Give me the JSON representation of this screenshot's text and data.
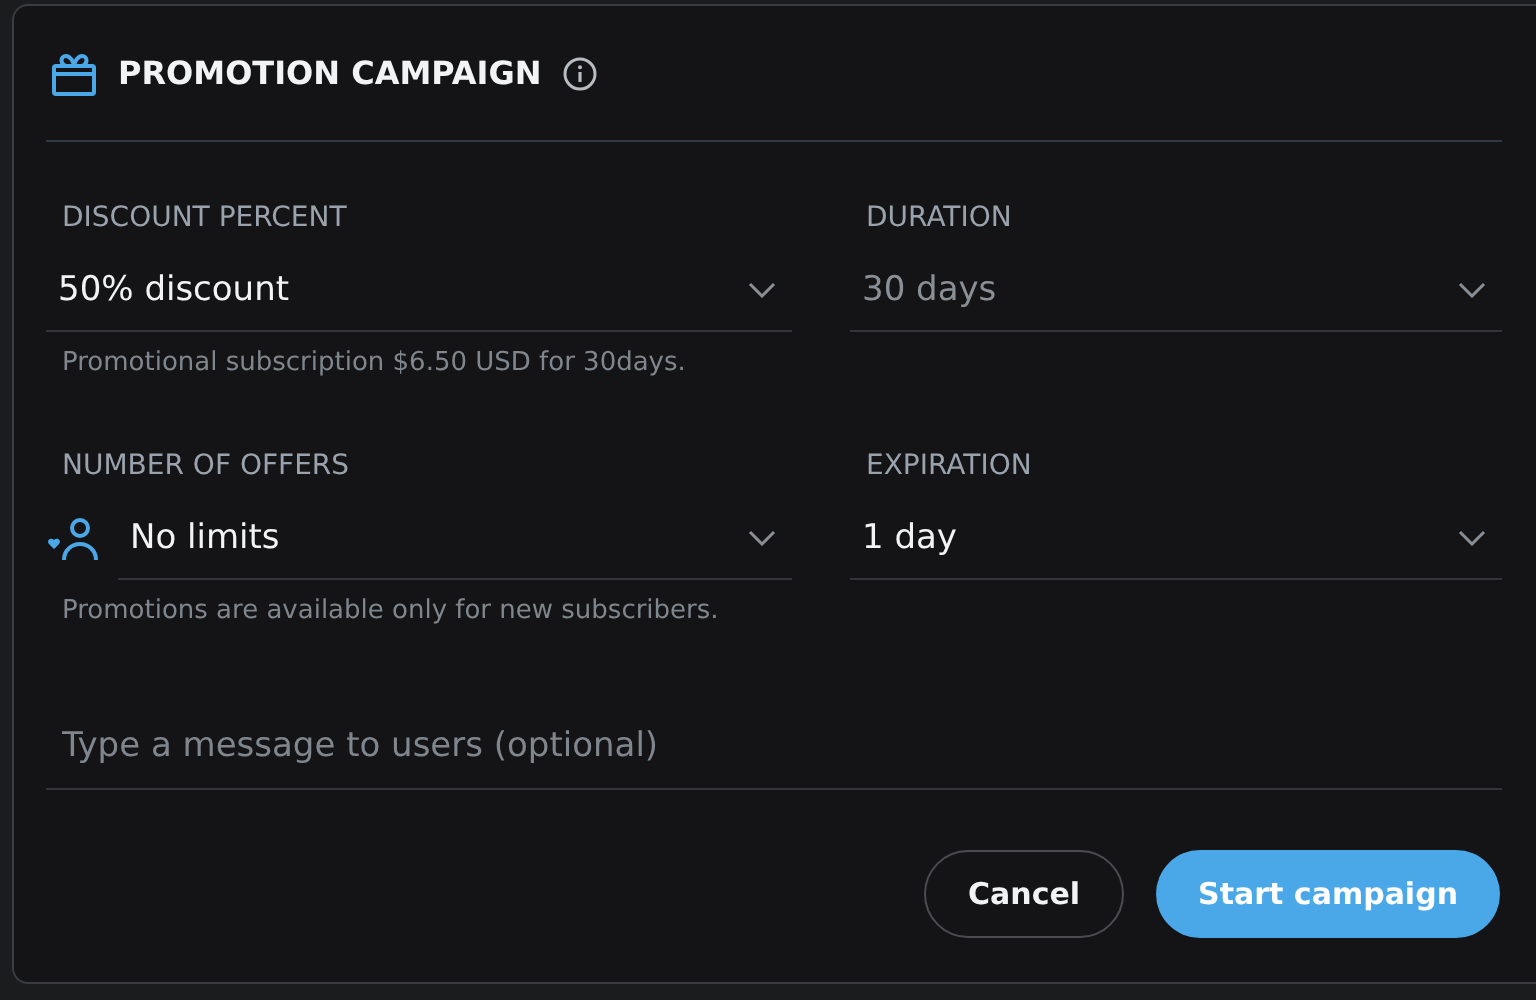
{
  "dialog": {
    "title": "PROMOTION CAMPAIGN",
    "fields": [
      {
        "label": "DISCOUNT PERCENT",
        "value": "50% discount",
        "disabled": false,
        "hint": "Promotional subscription $6.50 USD for 30days.",
        "kind": "plain"
      },
      {
        "label": "DURATION",
        "value": "30 days",
        "disabled": true,
        "kind": "plain"
      },
      {
        "label": "NUMBER OF OFFERS",
        "value": "No limits",
        "disabled": false,
        "hint": "Promotions are available only for new subscribers.",
        "kind": "audience"
      },
      {
        "label": "EXPIRATION",
        "value": "1 day",
        "disabled": false,
        "kind": "plain"
      }
    ],
    "message": {
      "placeholder": "Type a message to users (optional)"
    },
    "buttons": [
      {
        "label": "Cancel",
        "kind": "secondary"
      },
      {
        "label": "Start campaign",
        "kind": "primary"
      }
    ]
  }
}
